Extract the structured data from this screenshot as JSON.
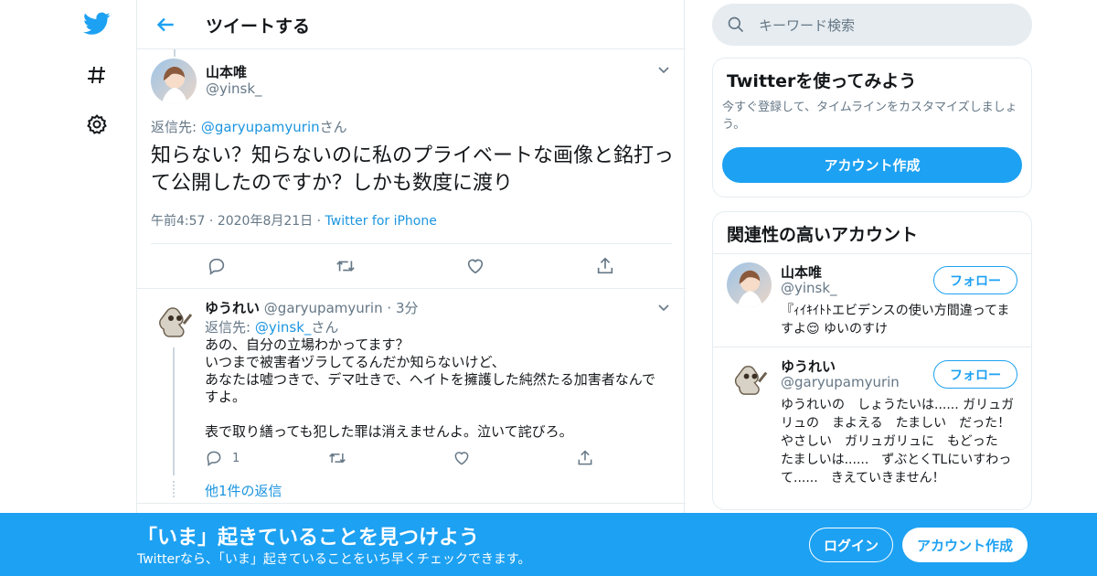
{
  "nav": {
    "icons": [
      "twitter-bird-icon",
      "hashtag-icon",
      "settings-gear-icon"
    ]
  },
  "header": {
    "title": "ツイートする"
  },
  "tweet": {
    "name": "山本唯",
    "handle": "@yinsk_",
    "reply_prefix": "返信先: ",
    "reply_to": "@garyupamyurin",
    "reply_suffix": "さん",
    "text": "知らない？知らないのに私のプライベートな画像と銘打って公開したのですか？しかも数度に渡り",
    "time": "午前4:57",
    "sep": "·",
    "date": "2020年8月21日",
    "client": "Twitter for iPhone"
  },
  "reply": {
    "name": "ゆうれい",
    "handle": "@garyupamyurin",
    "sep": "·",
    "ago": "3分",
    "reply_prefix": "返信先: ",
    "reply_to": "@yinsk_",
    "reply_suffix": "さん",
    "lines": [
      "あの、自分の立場わかってます？",
      "いつまで被害者ヅラしてるんだか知らないけど、",
      "あなたは嘘つきで、デマ吐きで、ヘイトを擁護した純然たる加害者なんで",
      "すよ。",
      "",
      "表で取り繕っても犯した罪は消えませんよ。泣いて詫びろ。"
    ],
    "reply_count": "1",
    "more_replies": "他1件の返信"
  },
  "search": {
    "placeholder": "キーワード検索"
  },
  "signup_card": {
    "title": "Twitterを使ってみよう",
    "desc": "今すぐ登録して、タイムラインをカスタマイズしましょう。",
    "button": "アカウント作成"
  },
  "related": {
    "title": "関連性の高いアカウント",
    "accounts": [
      {
        "name": "山本唯",
        "handle": "@yinsk_",
        "bio": "『ｨｲｷｲﾄﾄエビデンスの使い方間違ってますよ😌 ゆいのすけ",
        "follow": "フォロー"
      },
      {
        "name": "ゆうれい",
        "handle": "@garyupamyurin",
        "bio": "ゆうれいの　しょうたいは...... ガリュガリュの　まよえる　たましい　だった！ やさしい　ガリュガリュに　もどった　たましいは......　ずぶとくTLにいすわって......　きえていきません！",
        "follow": "フォロー"
      }
    ]
  },
  "bottom": {
    "headline": "「いま」起きていることを見つけよう",
    "sub": "Twitterなら、「いま」起きていることをいち早くチェックできます。",
    "login": "ログイン",
    "signup": "アカウント作成"
  },
  "colors": {
    "accent": "#1da1f2",
    "link": "#1b95e0",
    "muted": "#657786",
    "border": "#e6ecf0"
  }
}
